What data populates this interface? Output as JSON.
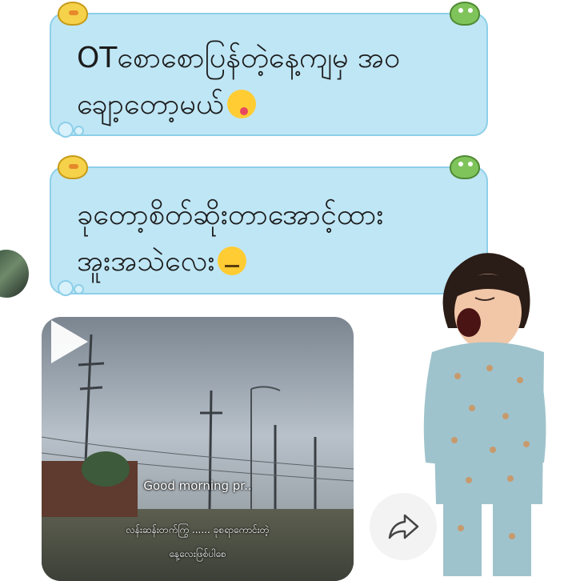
{
  "messages": [
    {
      "line1": "OTစောစောပြန်တဲ့နေ့ကျမှ အဝ",
      "line2": "ချော့တော့မယ်",
      "emoji": "winking-face-with-tongue"
    },
    {
      "line1": "ခုတော့စိတ်ဆိုးတာအောင့်ထား",
      "line2": "အူးအသဲလေး",
      "emoji": "neutral-face"
    }
  ],
  "video_post": {
    "caption_line1": "Good morning pr..",
    "caption_line2": "လန်းဆန်းတက်ကြွ ...... ခုစရာကောင်းတဲ့",
    "caption_line3": "နေ့လေးဖြစ်ပါစေ"
  },
  "colors": {
    "bubble_fill": "#bfe6f5",
    "bubble_border": "#8dcfe9"
  }
}
